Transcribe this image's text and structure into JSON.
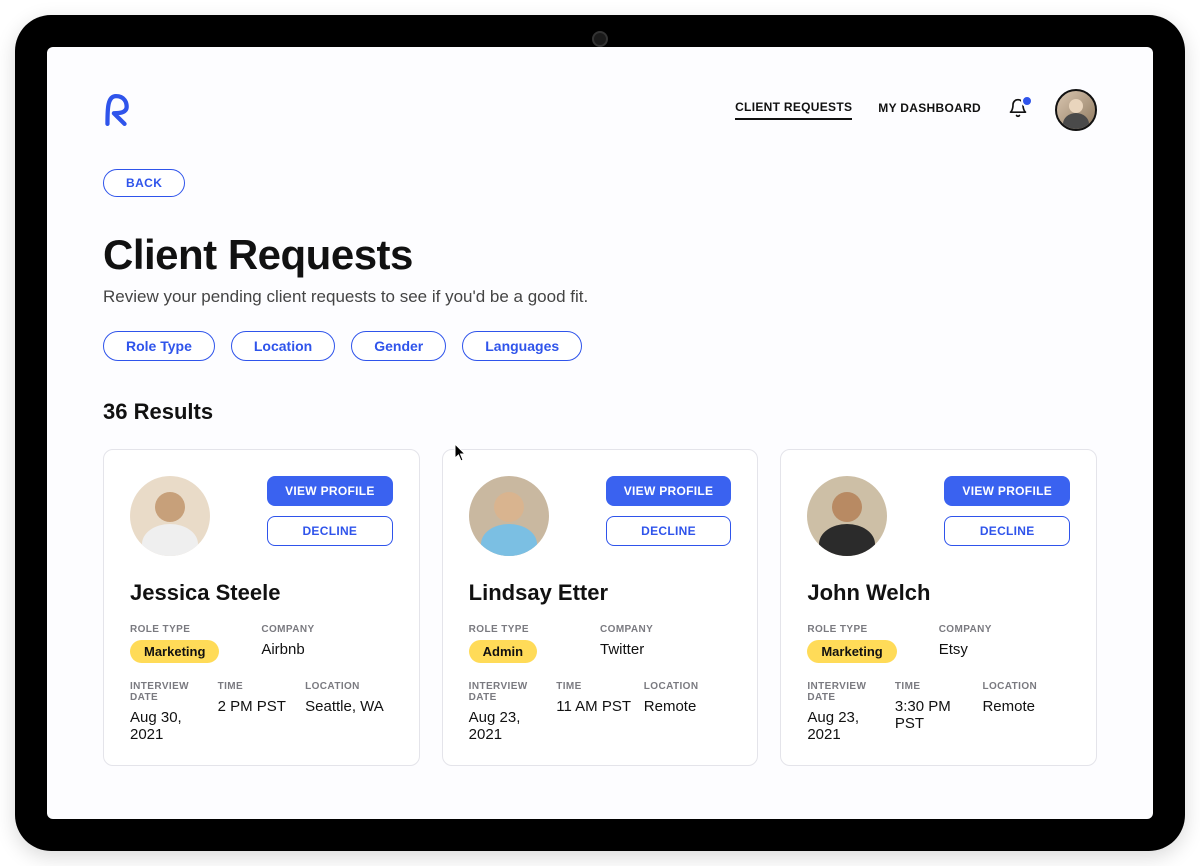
{
  "header": {
    "nav": [
      {
        "label": "CLIENT REQUESTS",
        "active": true
      },
      {
        "label": "MY DASHBOARD",
        "active": false
      }
    ]
  },
  "back_label": "BACK",
  "page": {
    "title": "Client Requests",
    "subtitle": "Review your pending client requests to see if you'd be a good fit."
  },
  "filters": [
    "Role Type",
    "Location",
    "Gender",
    "Languages"
  ],
  "results_count_label": "36 Results",
  "labels": {
    "role_type": "ROLE TYPE",
    "company": "COMPANY",
    "interview_date": "INTERVIEW DATE",
    "time": "TIME",
    "location": "LOCATION",
    "view_profile": "VIEW PROFILE",
    "decline": "DECLINE"
  },
  "cards": [
    {
      "name": "Jessica Steele",
      "role_type": "Marketing",
      "company": "Airbnb",
      "interview_date": "Aug 30, 2021",
      "time": "2 PM PST",
      "location": "Seattle, WA",
      "avatar_body": "#efefef"
    },
    {
      "name": "Lindsay Etter",
      "role_type": "Admin",
      "company": "Twitter",
      "interview_date": "Aug 23, 2021",
      "time": "11 AM PST",
      "location": "Remote",
      "avatar_body": "#7bbfe3"
    },
    {
      "name": "John Welch",
      "role_type": "Marketing",
      "company": "Etsy",
      "interview_date": "Aug 23, 2021",
      "time": "3:30 PM PST",
      "location": "Remote",
      "avatar_body": "#2b2b2b"
    }
  ]
}
